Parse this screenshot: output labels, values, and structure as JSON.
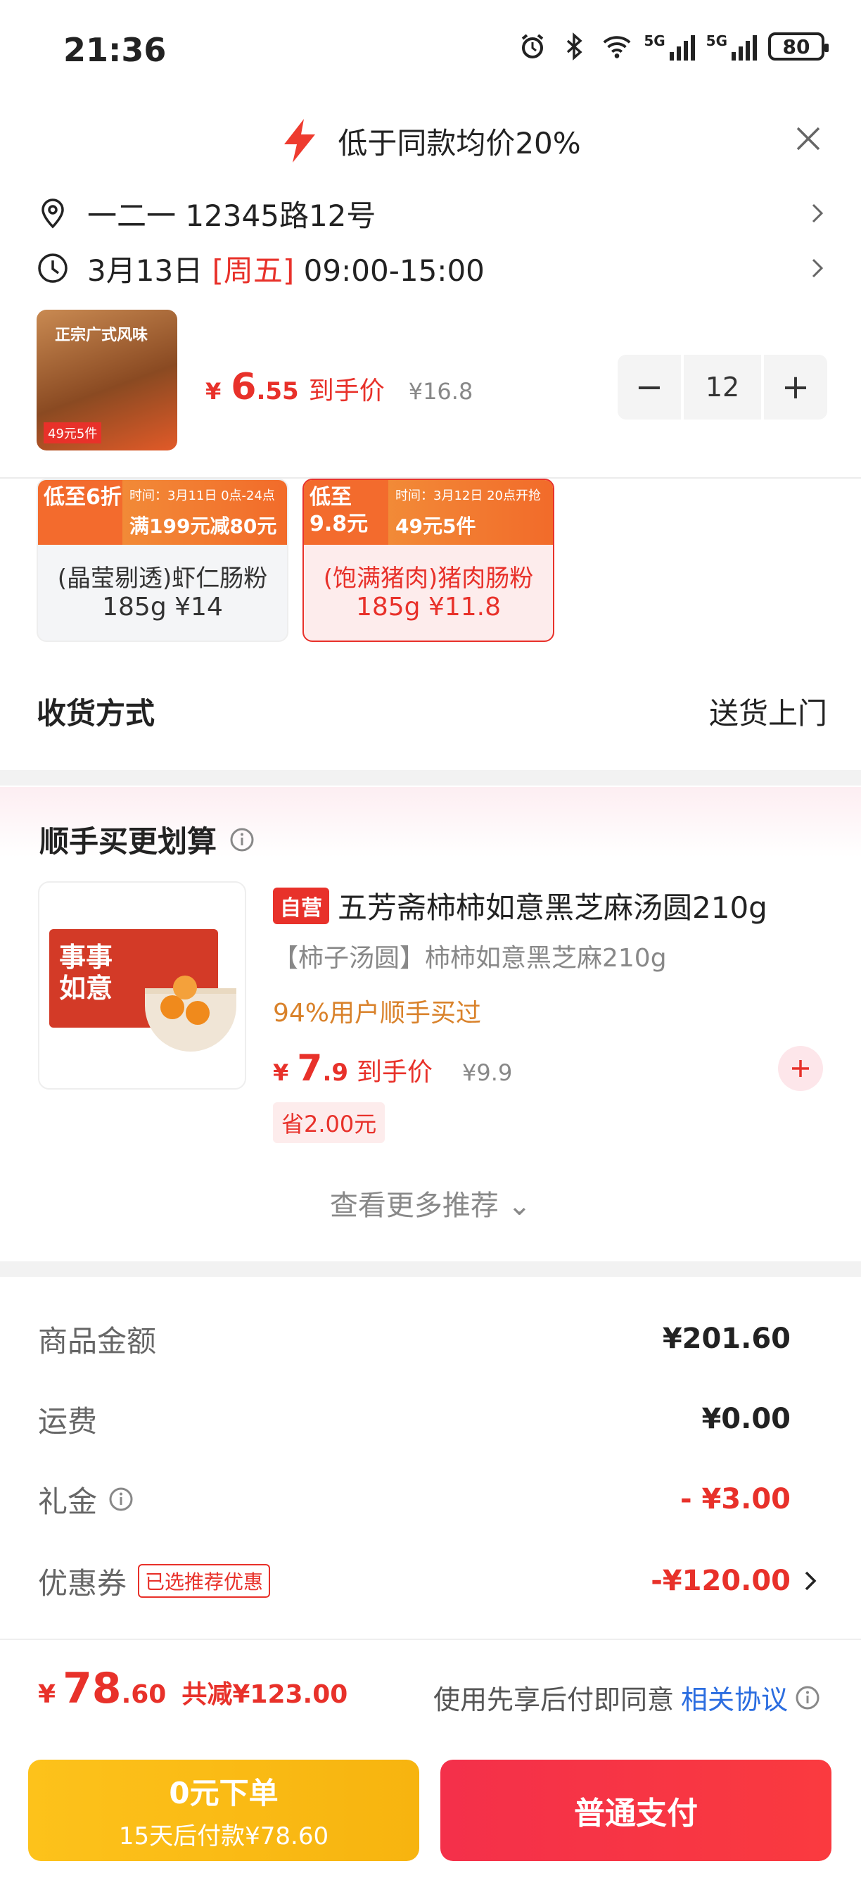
{
  "status_bar": {
    "time": "21:36",
    "signal1": "5G",
    "signal2": "5G",
    "battery": "80"
  },
  "header": {
    "promo_text": "低于同款均价20%"
  },
  "address": {
    "text": "一二一  12345路12号"
  },
  "delivery": {
    "date": "3月13日",
    "weekday": "[周五]",
    "time": "09:00-15:00"
  },
  "product": {
    "thumb_tag": "正宗广式风味",
    "thumb_promo": "49元5件",
    "price_yen": "¥",
    "price_int": "6",
    "price_dec": ".55",
    "price_label": "到手价",
    "orig_price": "¥16.8",
    "qty": "12",
    "minus": "−",
    "plus": "+"
  },
  "variants": [
    {
      "low_text": "低至6折",
      "time": "时间：3月11日 0点-24点",
      "deal": "满199元减80元",
      "name": "(晶莹剔透)虾仁肠粉",
      "spec": "185g ¥14",
      "selected": false
    },
    {
      "low_text": "低至9.8元",
      "time": "时间：3月12日 20点开抢",
      "deal": "49元5件",
      "name": "(饱满猪肉)猪肉肠粉",
      "spec": "185g ¥11.8",
      "selected": true
    }
  ],
  "receive": {
    "label": "收货方式",
    "value": "送货上门"
  },
  "recommend": {
    "title": "顺手买更划算",
    "badge": "自营",
    "name": "五芳斋柿柿如意黑芝麻汤圆210g",
    "subtitle": "【柿子汤圆】柿柿如意黑芝麻210g",
    "bought": "94%用户顺手买过",
    "price_yen": "¥",
    "price_int": "7",
    "price_dec": ".9",
    "price_label": "到手价",
    "orig_price": "¥9.9",
    "save": "省2.00元",
    "pack_text": "事事如意",
    "more": "查看更多推荐 ⌄"
  },
  "amounts": {
    "goods_label": "商品金额",
    "goods_value": "¥201.60",
    "ship_label": "运费",
    "ship_value": "¥0.00",
    "gift_label": "礼金",
    "gift_value": "- ¥3.00",
    "coupon_label": "优惠券",
    "coupon_tag": "已选推荐优惠",
    "coupon_value": "-¥120.00"
  },
  "summary": {
    "yen": "¥",
    "int": "78",
    "dec": ".60",
    "cut": "共减¥123.00",
    "agree_text": "使用先享后付即同意",
    "agree_link": "相关协议"
  },
  "buttons": {
    "later_title": "0元下单",
    "later_sub": "15天后付款¥78.60",
    "pay": "普通支付"
  },
  "colors": {
    "accent": "#e8312a",
    "link": "#2b6de0",
    "later_btn": "#fdc21b",
    "pay_btn": "#f4304a"
  }
}
